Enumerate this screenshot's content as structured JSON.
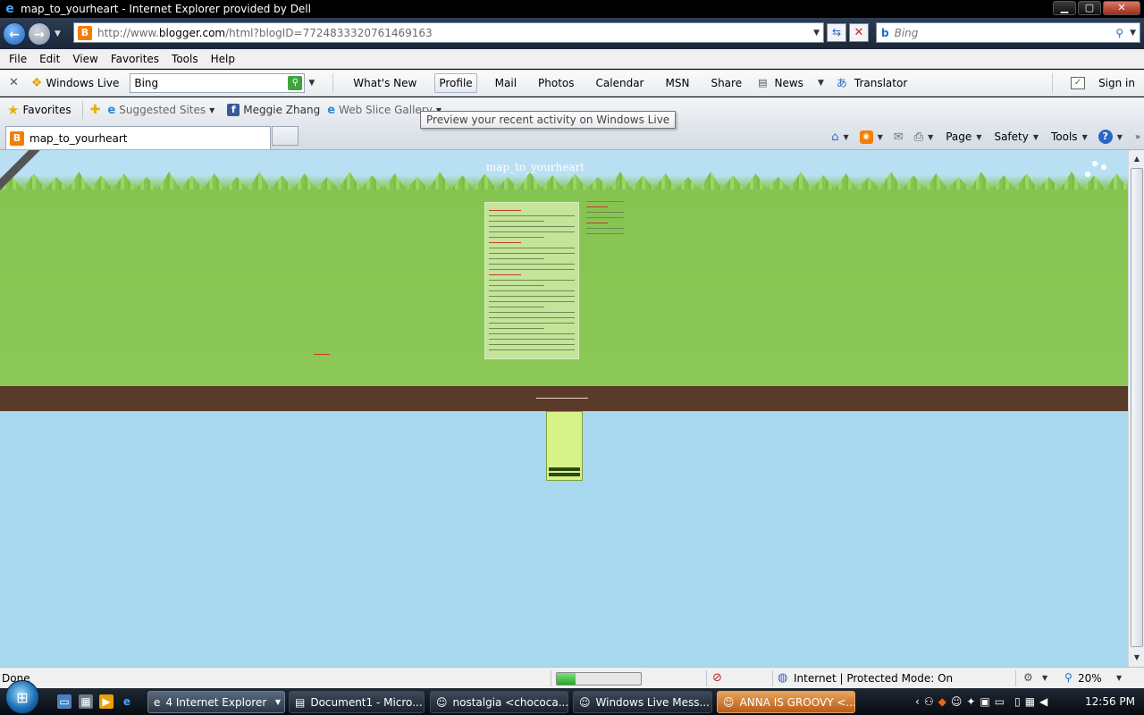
{
  "window": {
    "title": "map_to_yourheart - Internet Explorer provided by Dell",
    "minimize": "▁",
    "maximize": "▢",
    "close": "✕"
  },
  "address_bar": {
    "url_prefix": "http://www.",
    "url_domain": "blogger.com",
    "url_rest": "/html?blogID=7724833320761469163",
    "search_placeholder": "Bing"
  },
  "menu": {
    "items": [
      "File",
      "Edit",
      "View",
      "Favorites",
      "Tools",
      "Help"
    ]
  },
  "live_toolbar": {
    "brand": "Windows Live",
    "search_value": "Bing",
    "links": [
      "What's New",
      "Profile",
      "Mail",
      "Photos",
      "Calendar",
      "MSN",
      "Share"
    ],
    "news": "News",
    "translator": "Translator",
    "sign_in": "Sign in"
  },
  "favorites_bar": {
    "favorites": "Favorites",
    "suggested_sites": "Suggested Sites",
    "facebook_item": "Meggie Zhang",
    "web_slice": "Web Slice Gallery",
    "tooltip": "Preview your recent activity on Windows Live"
  },
  "tabs": {
    "active_label": "map_to_yourheart"
  },
  "command_bar": {
    "page": "Page",
    "safety": "Safety",
    "tools": "Tools"
  },
  "page": {
    "blog_title": "map_to_yourheart"
  },
  "status_bar": {
    "status": "Done",
    "progress": 0.22,
    "zone": "Internet | Protected Mode: On",
    "zoom": "20%"
  },
  "taskbar": {
    "buttons": [
      {
        "label": "4 Internet Explorer",
        "icon": "ie-icon"
      },
      {
        "label": "Document1 - Micro...",
        "icon": "word-icon"
      },
      {
        "label": "nostalgia <chococa...",
        "icon": "messenger-icon"
      },
      {
        "label": "Windows Live Mess...",
        "icon": "messenger-icon"
      },
      {
        "label": "ANNA IS GROOVY <...",
        "icon": "messenger-icon"
      }
    ],
    "clock": "12:56 PM"
  },
  "colors": {
    "sky": "#a8d8ee",
    "grass": "#8cc857",
    "dirt": "#5a3a28",
    "accent_orange": "#f57d00"
  }
}
